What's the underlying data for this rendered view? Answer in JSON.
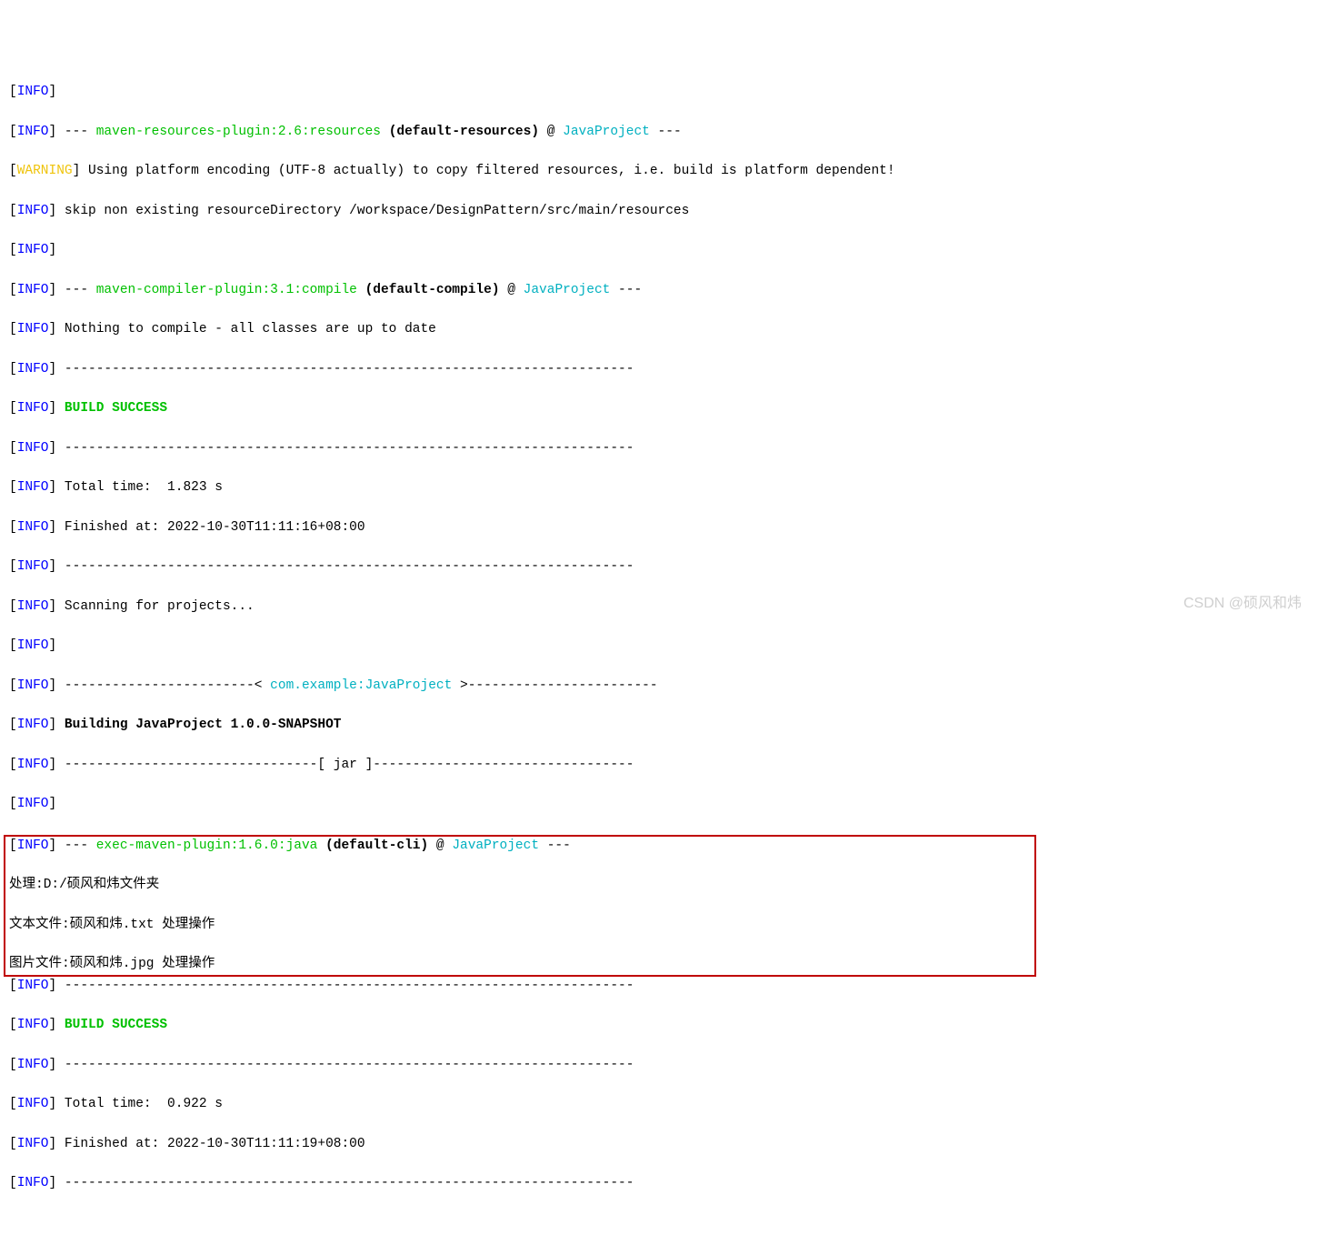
{
  "labels": {
    "infoOpen": "[",
    "infoClose": "]",
    "info": "INFO",
    "warning": "WARNING"
  },
  "lines": {
    "l1_pre": " --- ",
    "l1_plugin": "maven-resources-plugin:2.6:resources",
    "l1_mid": " ",
    "l1_b": "(default-resources)",
    "l1_at": " @ ",
    "l1_proj": "JavaProject",
    "l1_post": " ---",
    "l2": " Using platform encoding (UTF-8 actually) to copy filtered resources, i.e. build is platform dependent!",
    "l3": " skip non existing resourceDirectory /workspace/DesignPattern/src/main/resources",
    "l5_pre": " --- ",
    "l5_plugin": "maven-compiler-plugin:3.1:compile",
    "l5_mid": " ",
    "l5_b": "(default-compile)",
    "l5_at": " @ ",
    "l5_proj": "JavaProject",
    "l5_post": " ---",
    "l6": " Nothing to compile - all classes are up to date",
    "l7": " ------------------------------------------------------------------------",
    "l8": " BUILD SUCCESS",
    "l9": " ------------------------------------------------------------------------",
    "l10": " Total time:  1.823 s",
    "l11": " Finished at: 2022-10-30T11:11:16+08:00",
    "l12": " ------------------------------------------------------------------------",
    "l13": " Scanning for projects...",
    "l15_pre": " ------------------------< ",
    "l15_proj": "com.example:JavaProject",
    "l15_post": " >------------------------",
    "l16": " Building JavaProject 1.0.0-SNAPSHOT",
    "l17": " --------------------------------[ jar ]---------------------------------",
    "l19_pre": " --- ",
    "l19_plugin": "exec-maven-plugin:1.6.0:java",
    "l19_mid": " ",
    "l19_b": "(default-cli)",
    "l19_at": " @ ",
    "l19_proj": "JavaProject",
    "l19_post": " ---",
    "h1": "处理:D:/硕风和炜文件夹",
    "h2": "文本文件:硕风和炜.txt 处理操作",
    "h3": "图片文件:硕风和炜.jpg 处理操作",
    "l21": " ------------------------------------------------------------------------",
    "l22": " BUILD SUCCESS",
    "l23": " ------------------------------------------------------------------------",
    "l24": " Total time:  0.922 s",
    "l25": " Finished at: 2022-10-30T11:11:19+08:00",
    "l26": " ------------------------------------------------------------------------"
  },
  "watermark": "CSDN @硕风和炜"
}
